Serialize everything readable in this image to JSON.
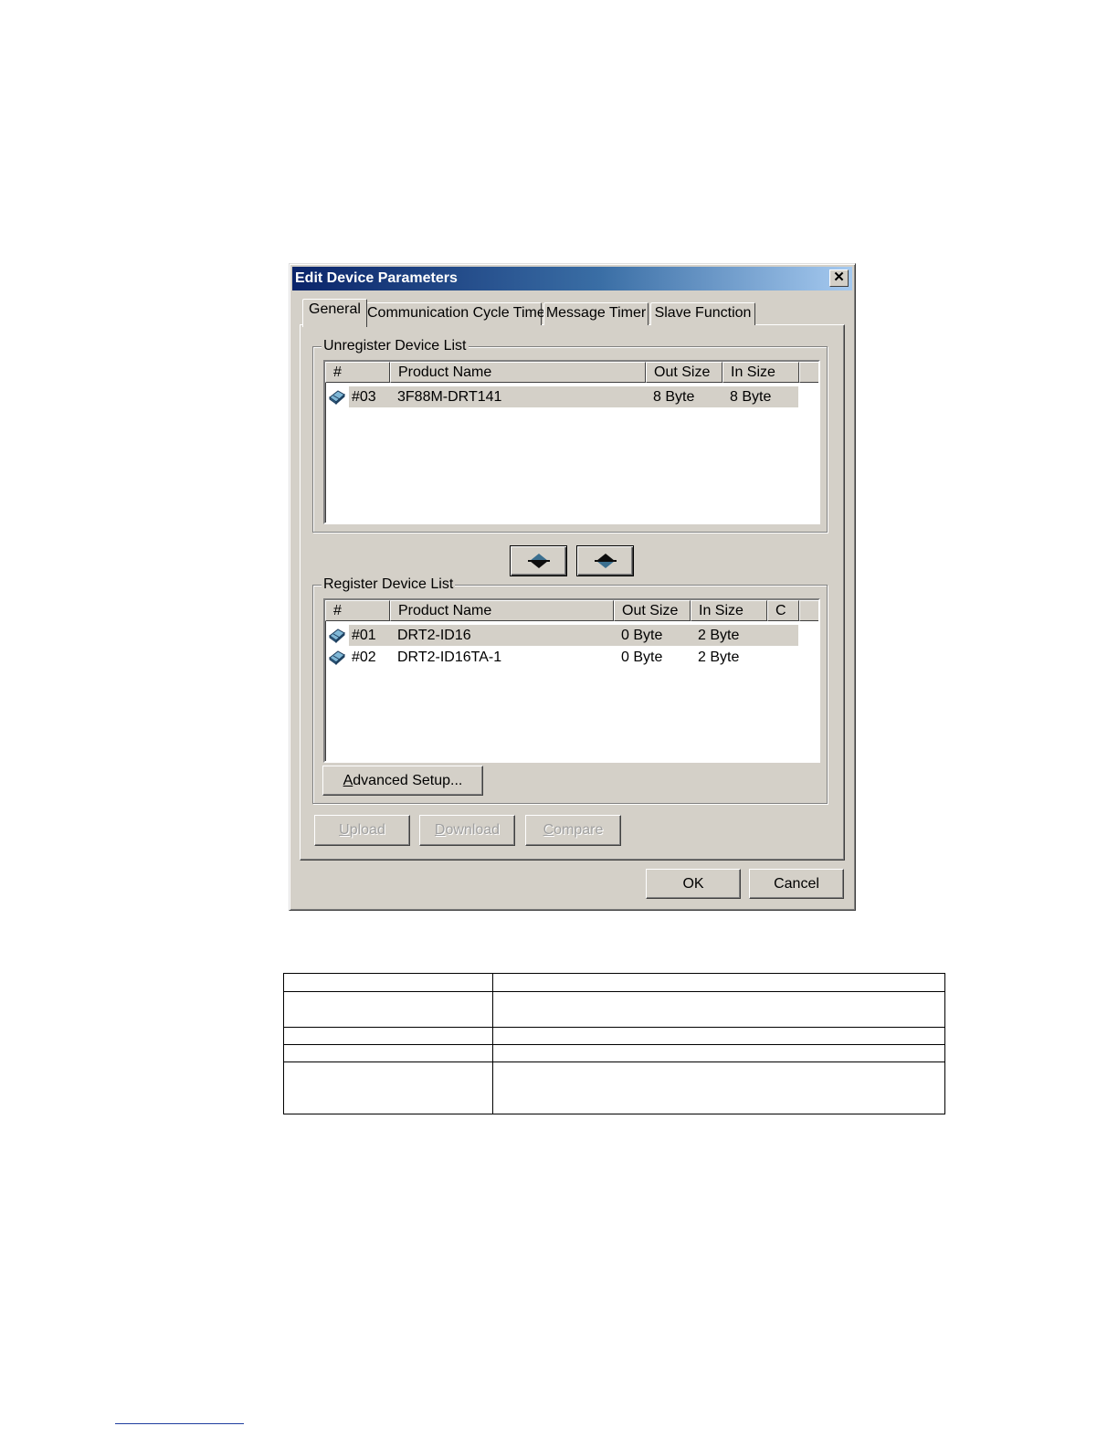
{
  "dialog": {
    "title": "Edit Device Parameters",
    "close_glyph": "✕"
  },
  "tabs": [
    {
      "label": "General",
      "active": true
    },
    {
      "label": "Communication Cycle Time",
      "active": false
    },
    {
      "label": "Message Timer",
      "active": false
    },
    {
      "label": "Slave Function",
      "active": false
    }
  ],
  "unregister_list": {
    "label": "Unregister Device List",
    "columns": [
      "#",
      "Product Name",
      "Out Size",
      "In Size"
    ],
    "rows": [
      {
        "num": "#03",
        "product": "3F88M-DRT141",
        "out": "8 Byte",
        "in": "8 Byte",
        "icon": "device-icon"
      }
    ]
  },
  "move_buttons": {
    "up_icon": "move-up-icon",
    "down_icon": "move-down-icon"
  },
  "register_list": {
    "label": "Register Device List",
    "columns": [
      "#",
      "Product Name",
      "Out Size",
      "In Size",
      "C"
    ],
    "rows": [
      {
        "num": "#01",
        "product": "DRT2-ID16",
        "out": "0 Byte",
        "in": "2 Byte",
        "icon": "device-icon"
      },
      {
        "num": "#02",
        "product": "DRT2-ID16TA-1",
        "out": "0 Byte",
        "in": "2 Byte",
        "icon": "device-icon"
      }
    ]
  },
  "buttons": {
    "advanced_setup_mnemonic": "A",
    "advanced_setup_rest": "dvanced Setup...",
    "upload_mnemonic": "U",
    "upload_rest": "pload",
    "download_mnemonic": "D",
    "download_rest": "ownload",
    "compare_mnemonic": "C",
    "compare_rest": "ompare",
    "ok": "OK",
    "cancel": "Cancel"
  },
  "colors": {
    "title_gradient_start": "#0a246a",
    "title_gradient_end": "#a6caf0",
    "window_face": "#d4d0c8",
    "footnote_rule": "#1f3f9f"
  }
}
